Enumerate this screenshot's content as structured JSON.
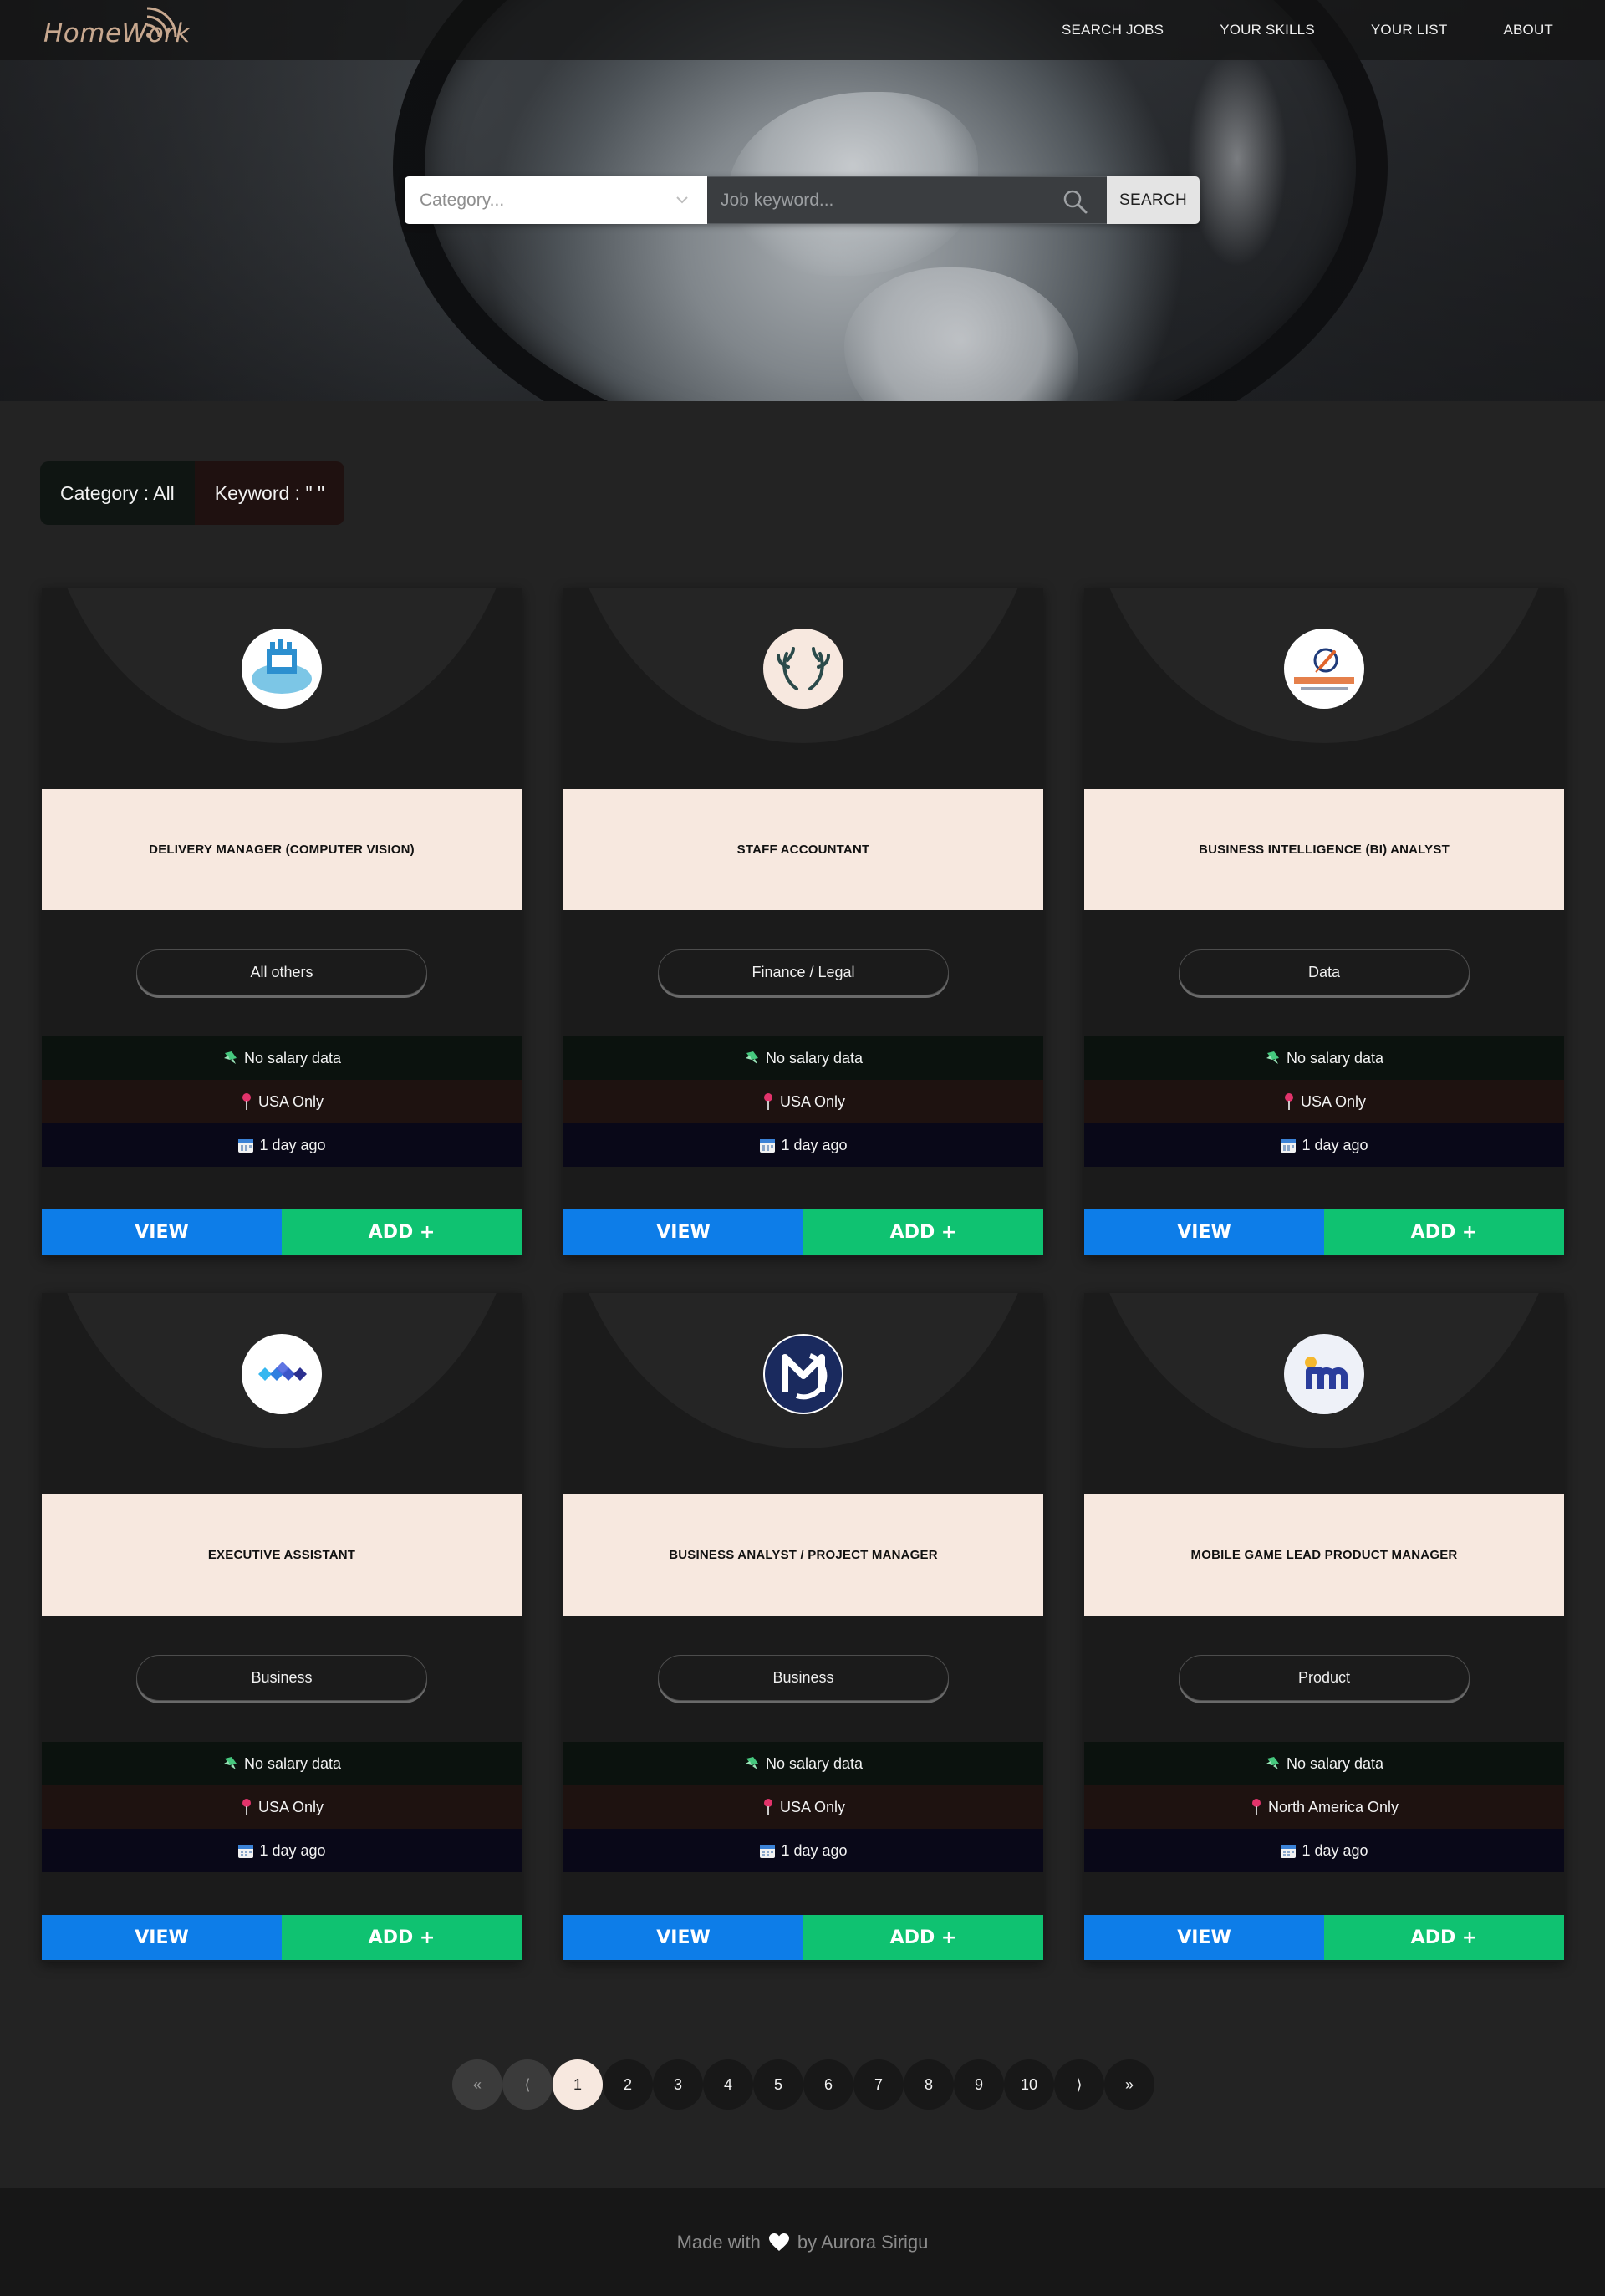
{
  "app": {
    "brand": "HomeWork"
  },
  "nav": {
    "items": [
      {
        "label": "SEARCH JOBS"
      },
      {
        "label": "YOUR SKILLS"
      },
      {
        "label": "YOUR LIST"
      },
      {
        "label": "ABOUT"
      }
    ]
  },
  "search": {
    "category_placeholder": "Category...",
    "keyword_placeholder": "Job keyword...",
    "keyword_value": "",
    "button_label": "SEARCH"
  },
  "filter": {
    "category_text": "Category : All",
    "keyword_text": "Keyword : \" \""
  },
  "labels": {
    "view": "VIEW",
    "add": "ADD +"
  },
  "jobs": [
    {
      "title": "DELIVERY MANAGER (COMPUTER VISION)",
      "category": "All others",
      "salary": "No salary data",
      "location": "USA Only",
      "posted": "1 day ago",
      "logo_icon": "talent-factory-logo"
    },
    {
      "title": "STAFF ACCOUNTANT",
      "category": "Finance / Legal",
      "salary": "No salary data",
      "location": "USA Only",
      "posted": "1 day ago",
      "logo_icon": "antlers-logo"
    },
    {
      "title": "BUSINESS INTELLIGENCE (BI) ANALYST",
      "category": "Data",
      "salary": "No salary data",
      "location": "USA Only",
      "posted": "1 day ago",
      "logo_icon": "talent-launch-logo"
    },
    {
      "title": "EXECUTIVE ASSISTANT",
      "category": "Business",
      "salary": "No salary data",
      "location": "USA Only",
      "posted": "1 day ago",
      "logo_icon": "blue-diamonds-logo"
    },
    {
      "title": "BUSINESS ANALYST / PROJECT MANAGER",
      "category": "Business",
      "salary": "No salary data",
      "location": "USA Only",
      "posted": "1 day ago",
      "logo_icon": "m-bubble-logo"
    },
    {
      "title": "MOBILE GAME LEAD PRODUCT MANAGER",
      "category": "Product",
      "salary": "No salary data",
      "location": "North America Only",
      "posted": "1 day ago",
      "logo_icon": "m-logo"
    }
  ],
  "pagination": {
    "first": "«",
    "prev": "⟨",
    "pages": [
      "1",
      "2",
      "3",
      "4",
      "5",
      "6",
      "7",
      "8",
      "9",
      "10"
    ],
    "current": "1",
    "next": "⟩",
    "last": "»"
  },
  "footer": {
    "prefix": "Made with",
    "suffix": "by Aurora Sirigu"
  },
  "colors": {
    "background": "#232323",
    "title_box": "#f7e8df",
    "view_button": "#0d7de8",
    "add_button": "#0fc271",
    "brand": "#c8a88f"
  }
}
